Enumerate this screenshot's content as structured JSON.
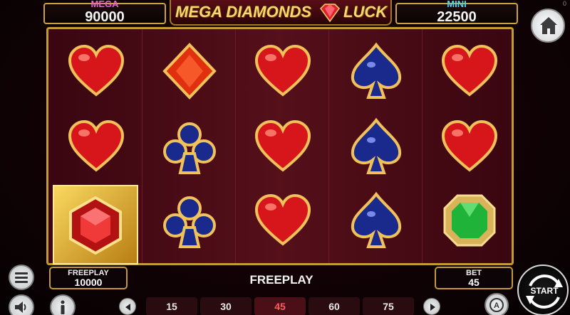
{
  "jackpots": {
    "mega": {
      "label": "MEGA",
      "value": "90000"
    },
    "mini": {
      "label": "MINI",
      "value": "22500"
    }
  },
  "logo": {
    "left": "MEGA DIAMONDS",
    "right": "LUCK"
  },
  "corner_indicator": "0",
  "reels": {
    "grid": [
      [
        "heart",
        "diamond",
        "heart",
        "spade",
        "heart"
      ],
      [
        "heart",
        "club",
        "heart",
        "spade",
        "heart"
      ],
      [
        "red-gem-wild",
        "club",
        "heart",
        "spade",
        "green-gem"
      ]
    ]
  },
  "freeplay_panel": {
    "label": "FREEPLAY",
    "value": "10000"
  },
  "center_label": "FREEPLAY",
  "bet_panel": {
    "label": "BET",
    "value": "45"
  },
  "bet_options": [
    "15",
    "30",
    "45",
    "60",
    "75"
  ],
  "selected_bet": "45",
  "start_button": {
    "label": "START"
  },
  "colors": {
    "gold": "#c49a35",
    "selected_bet": "#ff5c5c",
    "mega": "#e85fd4",
    "mini": "#52d6ef"
  },
  "icons": [
    "home-icon",
    "menu-icon",
    "sound-icon",
    "info-icon",
    "auto-icon",
    "arrow-left-icon",
    "arrow-right-icon"
  ]
}
